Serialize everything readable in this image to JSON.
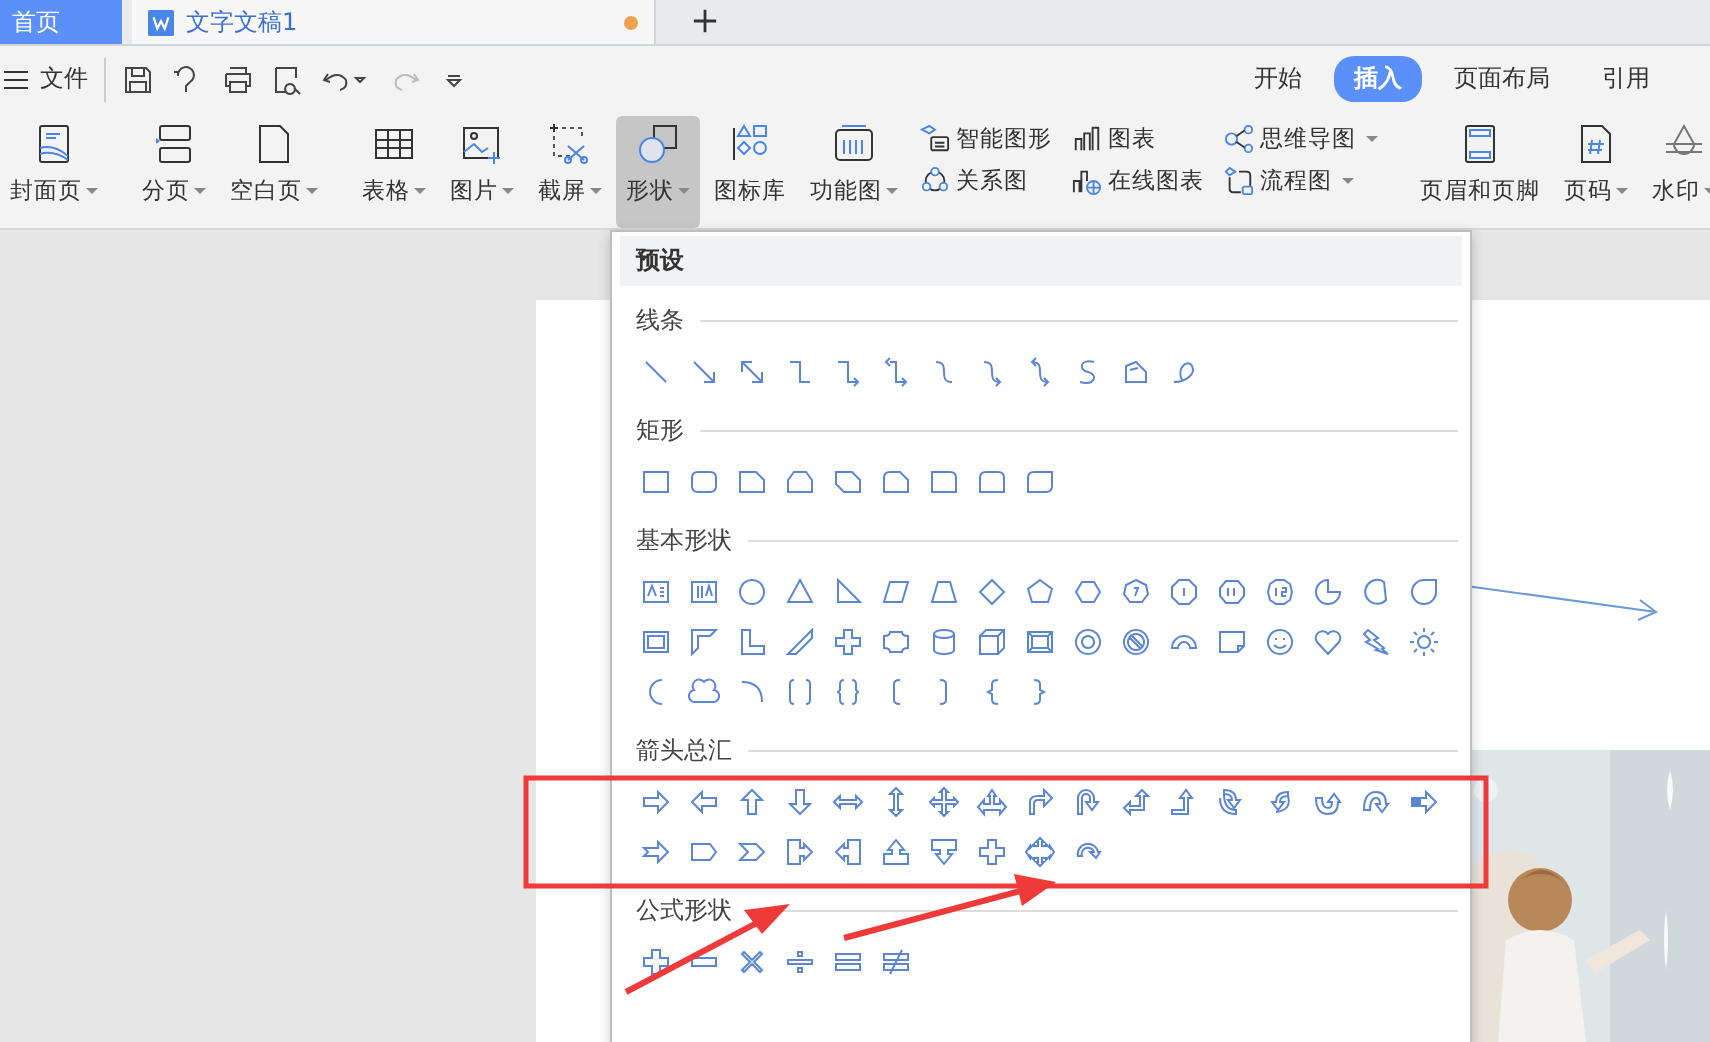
{
  "tabs": [
    {
      "label": "首页",
      "kind": "home",
      "selected": false
    },
    {
      "label": "文字文稿1",
      "kind": "doc",
      "selected": true,
      "unsaved": true
    }
  ],
  "menu_bar": {
    "file_label": "文件",
    "ribbon_tabs": [
      {
        "label": "开始",
        "selected": false
      },
      {
        "label": "插入",
        "selected": true
      },
      {
        "label": "页面布局",
        "selected": false
      },
      {
        "label": "引用",
        "selected": false
      }
    ]
  },
  "ribbon": {
    "groups": [
      [
        {
          "kind": "large",
          "label": "封面页",
          "dropdown": true,
          "pressed": false
        }
      ],
      [
        {
          "kind": "large",
          "label": "分页",
          "dropdown": true,
          "pressed": false
        },
        {
          "kind": "large",
          "label": "空白页",
          "dropdown": true,
          "pressed": false
        }
      ],
      [
        {
          "kind": "large",
          "label": "表格",
          "dropdown": true,
          "pressed": false
        },
        {
          "kind": "large",
          "label": "图片",
          "dropdown": true,
          "pressed": false
        },
        {
          "kind": "large",
          "label": "截屏",
          "dropdown": true,
          "pressed": false
        },
        {
          "kind": "large",
          "label": "形状",
          "dropdown": true,
          "pressed": true
        },
        {
          "kind": "large",
          "label": "图标库",
          "dropdown": false,
          "pressed": false
        },
        {
          "kind": "large",
          "label": "功能图",
          "dropdown": true,
          "pressed": false
        },
        {
          "kind": "stack",
          "items": [
            {
              "label": "智能图形",
              "dropdown": false
            },
            {
              "label": "关系图",
              "dropdown": false
            }
          ]
        },
        {
          "kind": "stack",
          "items": [
            {
              "label": "图表",
              "dropdown": false
            },
            {
              "label": "在线图表",
              "dropdown": false
            }
          ]
        },
        {
          "kind": "stack",
          "items": [
            {
              "label": "思维导图",
              "dropdown": true
            },
            {
              "label": "流程图",
              "dropdown": true
            }
          ]
        }
      ],
      [
        {
          "kind": "large",
          "label": "页眉和页脚",
          "dropdown": false,
          "pressed": false
        },
        {
          "kind": "large",
          "label": "页码",
          "dropdown": true,
          "pressed": false
        },
        {
          "kind": "large",
          "label": "水印",
          "dropdown": true,
          "pressed": false
        }
      ]
    ]
  },
  "shape_menu": {
    "header": "预设",
    "sections": [
      {
        "title": "线条",
        "kind": "lines"
      },
      {
        "title": "矩形",
        "kind": "rectangles"
      },
      {
        "title": "基本形状",
        "kind": "basic"
      },
      {
        "title": "箭头总汇",
        "kind": "arrows"
      },
      {
        "title": "公式形状",
        "kind": "equation"
      }
    ]
  }
}
